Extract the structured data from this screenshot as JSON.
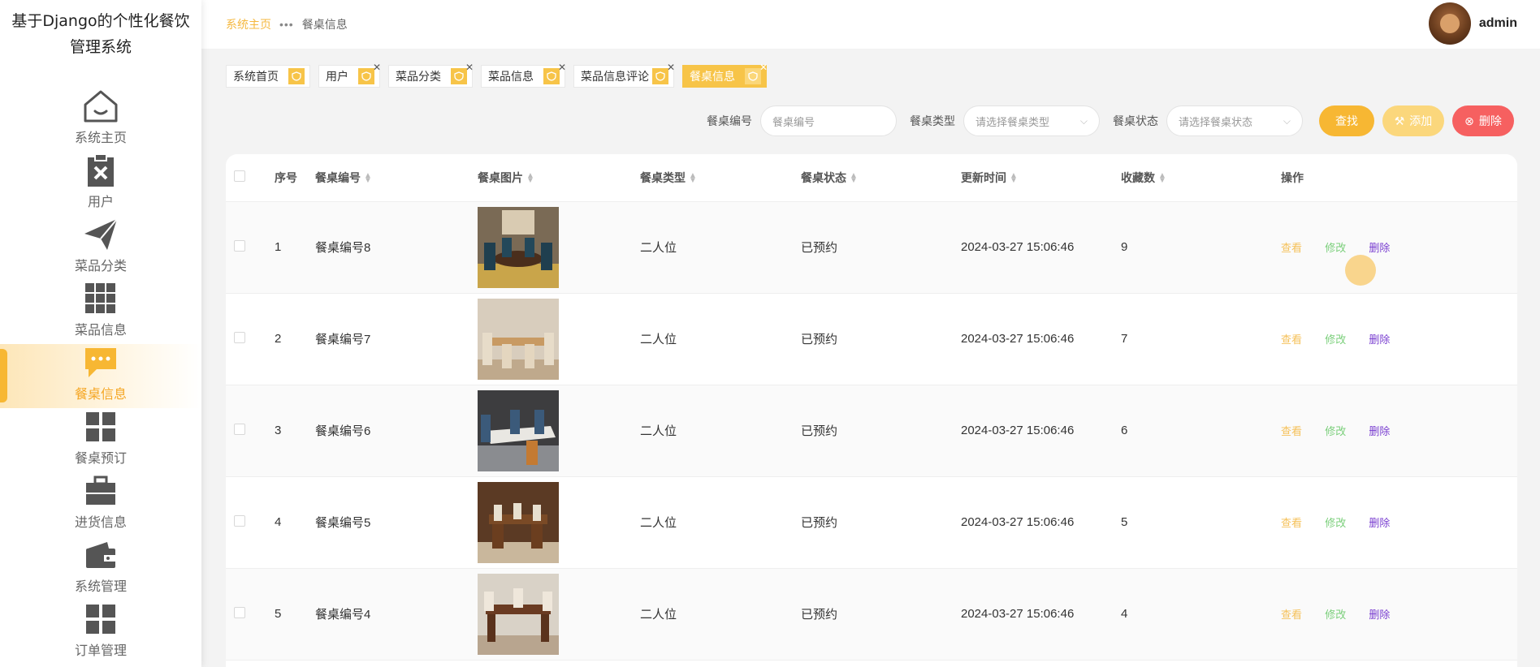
{
  "app": {
    "title_line1": "基于Django的个性化餐饮",
    "title_line2": "管理系统"
  },
  "sidebar": {
    "items": [
      {
        "label": "系统主页",
        "icon": "home-icon"
      },
      {
        "label": "用户",
        "icon": "clipboard-x-icon"
      },
      {
        "label": "菜品分类",
        "icon": "paper-plane-icon"
      },
      {
        "label": "菜品信息",
        "icon": "grid-icon"
      },
      {
        "label": "餐桌信息",
        "icon": "chat-icon",
        "active": true
      },
      {
        "label": "餐桌预订",
        "icon": "tiles-icon"
      },
      {
        "label": "进货信息",
        "icon": "briefcase-icon"
      },
      {
        "label": "系统管理",
        "icon": "wallet-icon"
      },
      {
        "label": "订单管理",
        "icon": "tiles-icon"
      }
    ]
  },
  "header": {
    "breadcrumb_home": "系统主页",
    "breadcrumb_sep": "•••",
    "breadcrumb_current": "餐桌信息",
    "username": "admin"
  },
  "tags": [
    {
      "label": "系统首页",
      "closable": false
    },
    {
      "label": "用户",
      "closable": true
    },
    {
      "label": "菜品分类",
      "closable": true
    },
    {
      "label": "菜品信息",
      "closable": true
    },
    {
      "label": "菜品信息评论",
      "closable": true
    },
    {
      "label": "餐桌信息",
      "closable": true,
      "active": true
    }
  ],
  "search": {
    "table_no_label": "餐桌编号",
    "table_no_placeholder": "餐桌编号",
    "table_type_label": "餐桌类型",
    "table_type_placeholder": "请选择餐桌类型",
    "table_status_label": "餐桌状态",
    "table_status_placeholder": "请选择餐桌状态",
    "search_btn": "查找",
    "add_btn": "添加",
    "delete_btn": "删除"
  },
  "table": {
    "columns": {
      "index": "序号",
      "table_no": "餐桌编号",
      "image": "餐桌图片",
      "type": "餐桌类型",
      "status": "餐桌状态",
      "updated": "更新时间",
      "favorites": "收藏数",
      "actions": "操作"
    },
    "action_labels": {
      "view": "查看",
      "edit": "修改",
      "delete": "删除"
    },
    "rows": [
      {
        "index": "1",
        "table_no": "餐桌编号8",
        "type": "二人位",
        "status": "已预约",
        "updated": "2024-03-27 15:06:46",
        "favorites": "9"
      },
      {
        "index": "2",
        "table_no": "餐桌编号7",
        "type": "二人位",
        "status": "已预约",
        "updated": "2024-03-27 15:06:46",
        "favorites": "7"
      },
      {
        "index": "3",
        "table_no": "餐桌编号6",
        "type": "二人位",
        "status": "已预约",
        "updated": "2024-03-27 15:06:46",
        "favorites": "6"
      },
      {
        "index": "4",
        "table_no": "餐桌编号5",
        "type": "二人位",
        "status": "已预约",
        "updated": "2024-03-27 15:06:46",
        "favorites": "5"
      },
      {
        "index": "5",
        "table_no": "餐桌编号4",
        "type": "二人位",
        "status": "已预约",
        "updated": "2024-03-27 15:06:46",
        "favorites": "4"
      }
    ]
  },
  "colors": {
    "accent": "#f7b733",
    "accent_light": "#fbd77c",
    "danger": "#f66060",
    "edit": "#7bcf7b",
    "delete_link": "#7a3fd0"
  }
}
